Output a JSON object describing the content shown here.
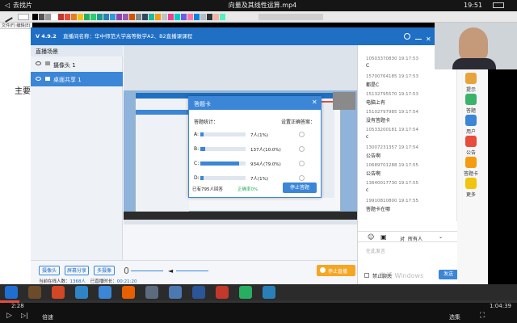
{
  "player": {
    "back_label": "去找片",
    "title": "向量及其线性运算.mp4",
    "clock": "19:51",
    "time_current": "2:28",
    "time_total": "1:04:39",
    "speed_label": "倍速",
    "episodes_label": "选集",
    "progress": 0.038
  },
  "whiteboard": {
    "menu": "文件(F)  编辑(E)",
    "left_text": "主要"
  },
  "app": {
    "version": "V 4.9.2",
    "room_name": "直播间名称：华中师范大学高等数学A2、B2直播课课程",
    "scene_tab": "直播场景",
    "sources": [
      {
        "label": "摄像头 1"
      },
      {
        "label": "桌面共享 1"
      }
    ],
    "buttons": {
      "camera": "摄像头",
      "screen_share": "屏幕分享",
      "multi_camera": "多摄像",
      "stop_live": "停止直播"
    },
    "status": {
      "online_prefix": "当前在线人数：",
      "online_count": "1368人",
      "duration_prefix": "已直播时长：",
      "duration": "00:21:20"
    }
  },
  "dialog": {
    "title": "答题卡",
    "stats_label": "答题统计：",
    "correct_label": "设置正确答案：",
    "options": [
      {
        "key": "A:",
        "count": "7人(1%)",
        "pct": 0.01
      },
      {
        "key": "B:",
        "count": "137人(10.0%)",
        "pct": 0.1
      },
      {
        "key": "C:",
        "count": "934人(79.0%)",
        "pct": 0.79
      },
      {
        "key": "D:",
        "count": "7人(1%)",
        "pct": 0.01
      }
    ],
    "answered": "已有795人回答",
    "accuracy": "正确率0%",
    "stop_button": "停止答题"
  },
  "chat": {
    "messages": [
      {
        "user": "10503370830",
        "time": "19:17:53",
        "text": "C"
      },
      {
        "user": "15700764185",
        "time": "19:17:53",
        "text": "都是C"
      },
      {
        "user": "15132795570",
        "time": "19:17:53",
        "text": "电脑上有"
      },
      {
        "user": "15102797985",
        "time": "19:17:54",
        "text": "没有答题卡"
      },
      {
        "user": "10533200181",
        "time": "19:17:54",
        "text": "c"
      },
      {
        "user": "13007231357",
        "time": "19:17:54",
        "text": "公告啊"
      },
      {
        "user": "10689701288",
        "time": "19:17:55",
        "text": "公告啊"
      },
      {
        "user": "13640017730",
        "time": "19:17:55",
        "text": "c"
      },
      {
        "user": "19910810800",
        "time": "19:17:55",
        "text": "答题卡在哪"
      }
    ],
    "to_label": "对",
    "target": "所有人",
    "input_placeholder": "在此发言",
    "mute_label": "禁止聊天",
    "send_label": "发送"
  },
  "side_nav": [
    {
      "label": "提示",
      "color": "#e8a33d"
    },
    {
      "label": "答题",
      "color": "#3bb36b"
    },
    {
      "label": "用户",
      "color": "#3b86d7"
    },
    {
      "label": "公告",
      "color": "#e74c3c"
    },
    {
      "label": "答题卡",
      "color": "#f39c12"
    },
    {
      "label": "更多",
      "color": "#f1c40f"
    }
  ],
  "taskbar_apps": [
    {
      "name": "start",
      "color": "#1e6fd0"
    },
    {
      "name": "app1",
      "color": "#6c4b2a"
    },
    {
      "name": "powerpoint",
      "color": "#d24726"
    },
    {
      "name": "app3",
      "color": "#2f84c6"
    },
    {
      "name": "app4",
      "color": "#3b86d7"
    },
    {
      "name": "firefox",
      "color": "#e66000"
    },
    {
      "name": "app6",
      "color": "#5a6c7d"
    },
    {
      "name": "app7",
      "color": "#4c79b0"
    },
    {
      "name": "word",
      "color": "#2a5699"
    },
    {
      "name": "app9",
      "color": "#c0392b"
    },
    {
      "name": "app10",
      "color": "#27ae60"
    },
    {
      "name": "app11",
      "color": "#2980b9"
    }
  ],
  "watermark": "激活 Windows",
  "colors": {
    "accent": "#1f6fc5",
    "accent_light": "#3b86d7",
    "stop": "#f5a623"
  }
}
